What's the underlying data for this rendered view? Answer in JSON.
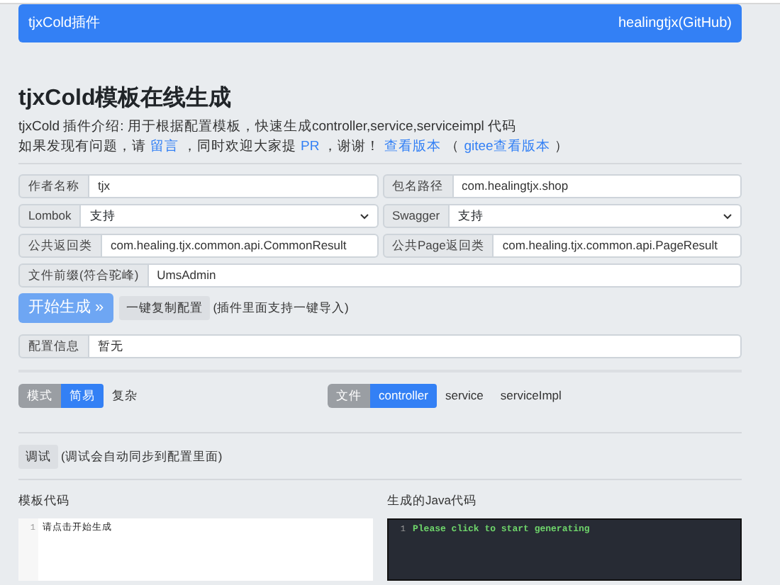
{
  "navbar": {
    "brand": "tjxCold插件",
    "link": "healingtjx(GitHub)"
  },
  "header": {
    "title": "tjxCold模板在线生成",
    "intro": "tjxCold 插件介绍: 用于根据配置模板，快速生成controller,service,serviceimpl 代码",
    "notice": [
      {
        "kind": "text",
        "text": "如果发现有问题，请"
      },
      {
        "kind": "link",
        "text": "留言"
      },
      {
        "kind": "text",
        "text": "，同时欢迎大家提"
      },
      {
        "kind": "link",
        "text": "PR"
      },
      {
        "kind": "text",
        "text": "，谢谢！"
      },
      {
        "kind": "link",
        "text": "查看版本"
      },
      {
        "kind": "text",
        "text": "（"
      },
      {
        "kind": "link",
        "text": "gitee查看版本"
      },
      {
        "kind": "text",
        "text": "）"
      }
    ]
  },
  "form_rows": [
    [
      {
        "label": "作者名称",
        "kind": "input",
        "value": "tjx"
      },
      {
        "label": "包名路径",
        "kind": "input",
        "value": "com.healingtjx.shop"
      }
    ],
    [
      {
        "label": "Lombok",
        "kind": "select",
        "value": "支持"
      },
      {
        "label": "Swagger",
        "kind": "select",
        "value": "支持"
      }
    ],
    [
      {
        "label": "公共返回类",
        "kind": "input",
        "value": "com.healing.tjx.common.api.CommonResult"
      },
      {
        "label": "公共Page返回类",
        "kind": "input",
        "value": "com.healing.tjx.common.api.PageResult"
      }
    ],
    [
      {
        "label": "文件前缀(符合驼峰)",
        "kind": "input",
        "value": "UmsAdmin"
      }
    ]
  ],
  "actions": {
    "start_button": "开始生成 »",
    "copy_button": "一键复制配置",
    "copy_hint": "(插件里面支持一键导入)"
  },
  "config_info": {
    "label": "配置信息",
    "value": "暂无"
  },
  "mode": {
    "label": "模式",
    "options": [
      {
        "label": "简易",
        "selected": true
      },
      {
        "label": "复杂",
        "selected": false
      }
    ]
  },
  "file": {
    "label": "文件",
    "options": [
      {
        "label": "controller",
        "selected": true
      },
      {
        "label": "service",
        "selected": false
      },
      {
        "label": "serviceImpl",
        "selected": false
      }
    ]
  },
  "debug": {
    "button": "调试",
    "hint": "(调试会自动同步到配置里面)"
  },
  "editors": [
    {
      "title": "模板代码",
      "kind": "light",
      "lines": [
        {
          "number": "1",
          "text": "请点击开始生成"
        }
      ]
    },
    {
      "title": "生成的Java代码",
      "kind": "dark",
      "lines": [
        {
          "number": "1",
          "text": "Please click to start generating"
        }
      ]
    }
  ]
}
